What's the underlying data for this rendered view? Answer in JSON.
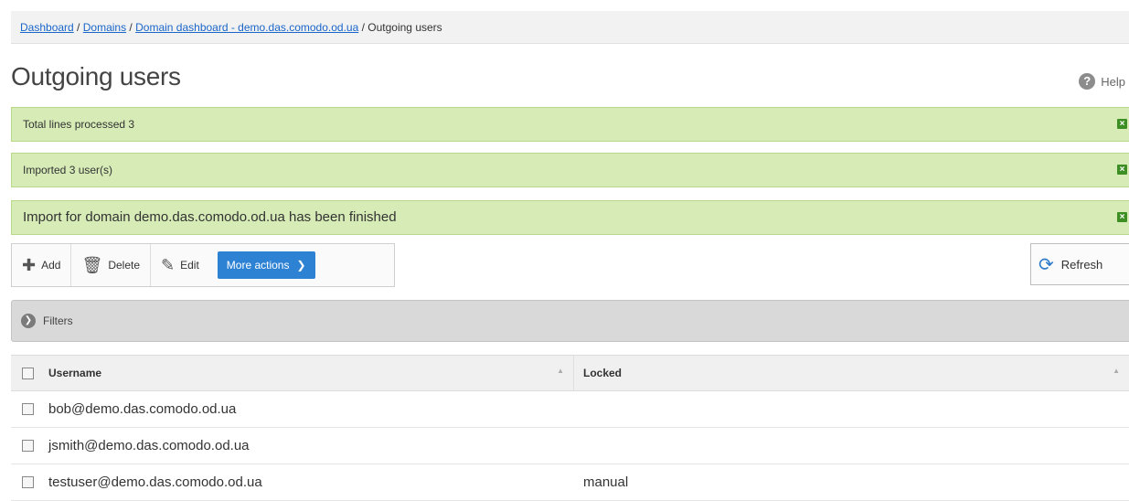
{
  "breadcrumb": {
    "dashboard": "Dashboard",
    "domains": "Domains",
    "domain_dashboard": "Domain dashboard - demo.das.comodo.od.ua",
    "current": "Outgoing users",
    "separator": " / "
  },
  "page": {
    "title": "Outgoing users",
    "help_label": "Help"
  },
  "alerts": [
    {
      "text": "Total lines processed 3"
    },
    {
      "text": "Imported 3 user(s)"
    },
    {
      "text": "Import for domain demo.das.comodo.od.ua has been finished"
    }
  ],
  "toolbar": {
    "add_label": "Add",
    "delete_label": "Delete",
    "edit_label": "Edit",
    "more_actions_label": "More actions",
    "refresh_label": "Refresh"
  },
  "filters": {
    "label": "Filters"
  },
  "table": {
    "columns": [
      "Username",
      "Locked"
    ],
    "rows": [
      {
        "username": "bob@demo.das.comodo.od.ua",
        "locked": ""
      },
      {
        "username": "jsmith@demo.das.comodo.od.ua",
        "locked": ""
      },
      {
        "username": "testuser@demo.das.comodo.od.ua",
        "locked": "manual"
      }
    ]
  },
  "colors": {
    "alert_bg": "#d6ebb6",
    "alert_close": "#3d8f24",
    "primary_button": "#2e82d4",
    "link": "#1a66c9"
  }
}
